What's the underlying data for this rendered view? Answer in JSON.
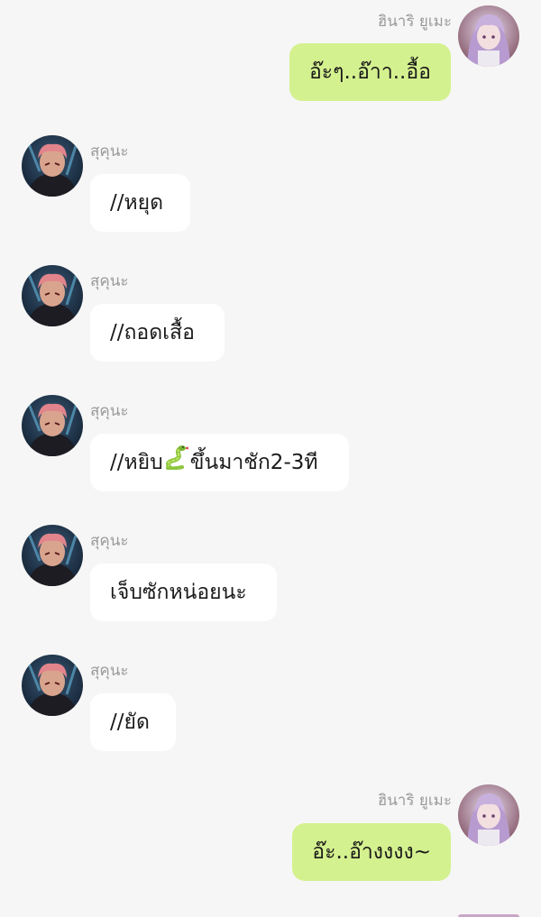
{
  "colors": {
    "background": "#f6f6f6",
    "self_bubble": "#d4f18f",
    "other_bubble": "#ffffff",
    "name_text": "#9a9a9a"
  },
  "messages": [
    {
      "sender": "ฮินาริ ยูเมะ",
      "text": "อ๊ะๆ..อ๊าา..อื้อ",
      "side": "self"
    },
    {
      "sender": "สุคุนะ",
      "text": "//หยุด",
      "side": "other"
    },
    {
      "sender": "สุคุนะ",
      "text": "//ถอดเสื้อ",
      "side": "other"
    },
    {
      "sender": "สุคุนะ",
      "text_before": "//หยิบ",
      "emoji": "snake-icon",
      "text_after": "ขึ้นมาชัก2-3ที",
      "side": "other"
    },
    {
      "sender": "สุคุนะ",
      "text": "เจ็บซักหน่อยนะ",
      "side": "other"
    },
    {
      "sender": "สุคุนะ",
      "text": "//ยัด",
      "side": "other"
    },
    {
      "sender": "ฮินาริ ยูเมะ",
      "text": "อ๊ะ..อ๊างงงง~",
      "side": "self"
    }
  ]
}
